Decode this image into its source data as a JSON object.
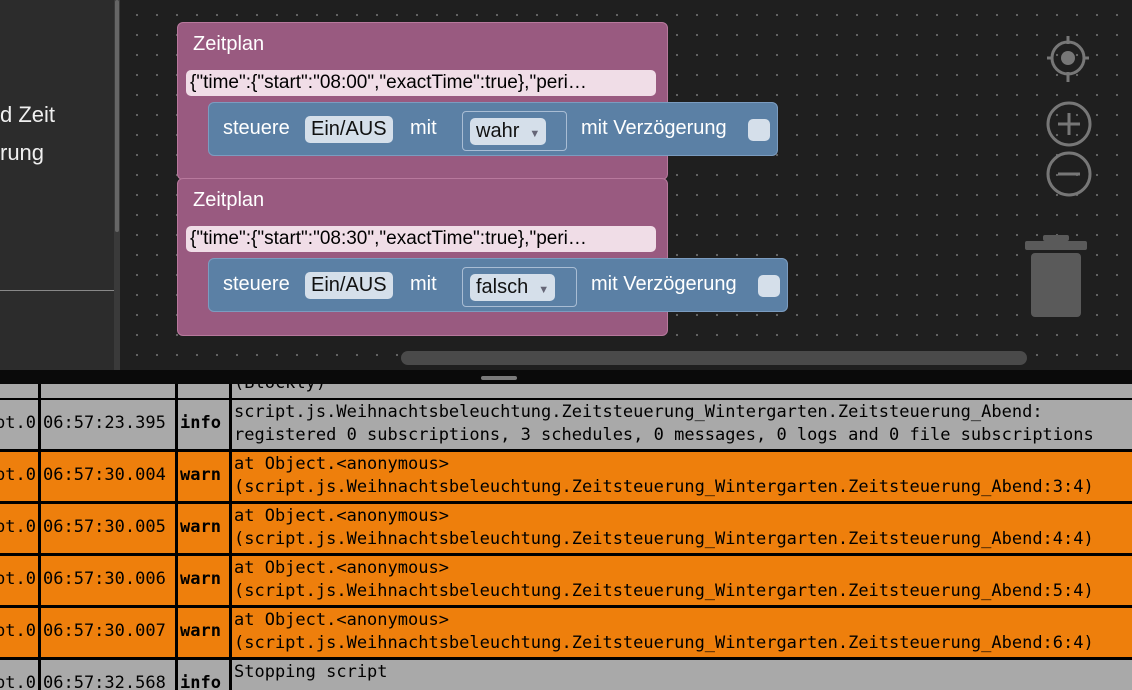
{
  "left_panel": {
    "line1": "d Zeit",
    "line2": "rung"
  },
  "blocks": [
    {
      "title": "Zeitplan",
      "schedule_json": "{\"time\":{\"start\":\"08:00\",\"exactTime\":true},\"peri…",
      "action": {
        "label_steuere": "steuere",
        "target": "Ein/AUS",
        "label_mit": "mit",
        "value": "wahr",
        "label_delay": "mit Verzögerung"
      }
    },
    {
      "title": "Zeitplan",
      "schedule_json": "{\"time\":{\"start\":\"08:30\",\"exactTime\":true},\"peri…",
      "action": {
        "label_steuere": "steuere",
        "target": "Ein/AUS",
        "label_mit": "mit",
        "value": "falsch",
        "label_delay": "mit Verzögerung"
      }
    }
  ],
  "workspace_controls": [
    "recenter-icon",
    "zoom-in-icon",
    "zoom-out-icon",
    "trash-icon"
  ],
  "log": {
    "partial_top": "(Blockly)",
    "rows": [
      {
        "source": "pt.0",
        "time": "06:57:23.395",
        "severity": "info",
        "line1": "script.js.Weihnachtsbeleuchtung.Zeitsteuerung_Wintergarten.Zeitsteuerung_Abend:",
        "line2": "registered 0 subscriptions, 3 schedules, 0 messages, 0 logs and 0 file subscriptions"
      },
      {
        "source": "pt.0",
        "time": "06:57:30.004",
        "severity": "warn",
        "line1": "at Object.<anonymous>",
        "line2": "(script.js.Weihnachtsbeleuchtung.Zeitsteuerung_Wintergarten.Zeitsteuerung_Abend:3:4)"
      },
      {
        "source": "pt.0",
        "time": "06:57:30.005",
        "severity": "warn",
        "line1": "at Object.<anonymous>",
        "line2": "(script.js.Weihnachtsbeleuchtung.Zeitsteuerung_Wintergarten.Zeitsteuerung_Abend:4:4)"
      },
      {
        "source": "pt.0",
        "time": "06:57:30.006",
        "severity": "warn",
        "line1": "at Object.<anonymous>",
        "line2": "(script.js.Weihnachtsbeleuchtung.Zeitsteuerung_Wintergarten.Zeitsteuerung_Abend:5:4)"
      },
      {
        "source": "pt.0",
        "time": "06:57:30.007",
        "severity": "warn",
        "line1": "at Object.<anonymous>",
        "line2": "(script.js.Weihnachtsbeleuchtung.Zeitsteuerung_Wintergarten.Zeitsteuerung_Abend:6:4)"
      },
      {
        "source": "pt.0",
        "time": "06:57:32.568",
        "severity": "info",
        "line1": "Stopping script",
        "line2": ""
      }
    ]
  },
  "colors": {
    "event_block": "#995a80",
    "action_block": "#5b80a5",
    "info_row": "#a9a9a9",
    "warn_row": "#ee7f0c"
  }
}
